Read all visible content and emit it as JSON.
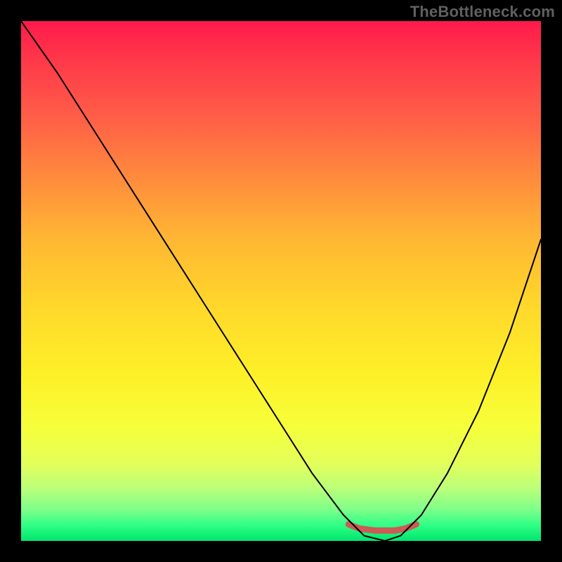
{
  "watermark": "TheBottleneck.com",
  "chart_data": {
    "type": "line",
    "title": "",
    "xlabel": "",
    "ylabel": "",
    "xlim": [
      0,
      100
    ],
    "ylim": [
      0,
      100
    ],
    "grid": false,
    "legend": false,
    "series": [
      {
        "name": "curve",
        "x": [
          0,
          7,
          14,
          21,
          28,
          35,
          42,
          49,
          56,
          62,
          66,
          70,
          73,
          77,
          82,
          88,
          94,
          100
        ],
        "values": [
          100,
          90,
          79,
          68,
          57,
          46,
          35,
          24,
          13,
          5,
          1,
          0,
          1,
          5,
          13,
          25,
          40,
          58
        ]
      },
      {
        "name": "highlight",
        "x": [
          63,
          65,
          68,
          70,
          72,
          74,
          76
        ],
        "values": [
          3.2,
          2.4,
          2.0,
          2.0,
          2.0,
          2.4,
          3.2
        ]
      }
    ],
    "styles": {
      "curve": {
        "color": "#000000",
        "width": 2.0,
        "type": "line"
      },
      "highlight": {
        "color": "#cc5a55",
        "width": 9,
        "type": "line"
      }
    },
    "background": "rainbow-vertical-gradient"
  }
}
